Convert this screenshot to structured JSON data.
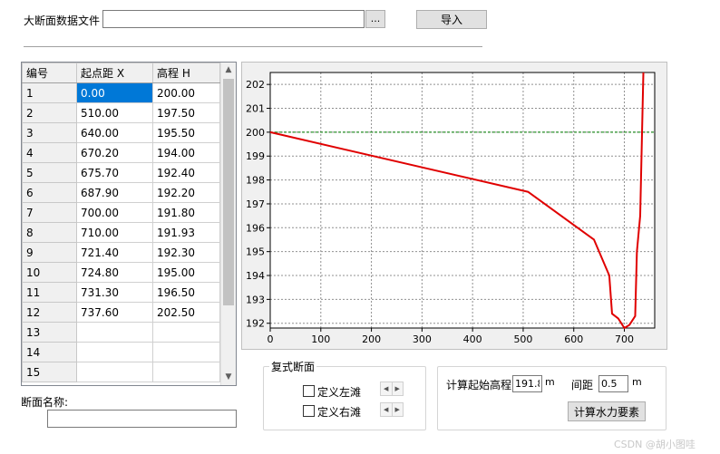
{
  "file_row": {
    "label": "大断面数据文件",
    "path_value": "",
    "browse_label": "...",
    "import_label": "导入"
  },
  "grid": {
    "headers": [
      "编号",
      "起点距 X",
      "高程 H"
    ],
    "rows": [
      [
        "1",
        "0.00",
        "200.00"
      ],
      [
        "2",
        "510.00",
        "197.50"
      ],
      [
        "3",
        "640.00",
        "195.50"
      ],
      [
        "4",
        "670.20",
        "194.00"
      ],
      [
        "5",
        "675.70",
        "192.40"
      ],
      [
        "6",
        "687.90",
        "192.20"
      ],
      [
        "7",
        "700.00",
        "191.80"
      ],
      [
        "8",
        "710.00",
        "191.93"
      ],
      [
        "9",
        "721.40",
        "192.30"
      ],
      [
        "10",
        "724.80",
        "195.00"
      ],
      [
        "11",
        "731.30",
        "196.50"
      ],
      [
        "12",
        "737.60",
        "202.50"
      ],
      [
        "13",
        "",
        ""
      ],
      [
        "14",
        "",
        ""
      ],
      [
        "15",
        "",
        ""
      ]
    ],
    "selected_row": 0,
    "scroll_up_icon": "chevron-up-icon",
    "scroll_down_icon": "chevron-down-icon"
  },
  "section_name": {
    "label": "断面名称:",
    "value": ""
  },
  "chart_data": {
    "type": "line",
    "xlim": [
      0,
      760
    ],
    "ylim": [
      191.8,
      202.5
    ],
    "xticks": [
      0,
      100,
      200,
      300,
      400,
      500,
      600,
      700
    ],
    "yticks": [
      192,
      193,
      194,
      195,
      196,
      197,
      198,
      199,
      200,
      201,
      202
    ],
    "grid": true,
    "series": [
      {
        "color": "#e00000",
        "x": [
          0,
          510,
          640,
          670.2,
          675.7,
          687.9,
          700,
          710,
          721.4,
          724.8,
          731.3,
          737.6
        ],
        "y": [
          200,
          197.5,
          195.5,
          194,
          192.4,
          192.2,
          191.8,
          191.93,
          192.3,
          195,
          196.5,
          202.5
        ]
      }
    ],
    "reference_line": {
      "y": 200,
      "color": "#008000",
      "style": "dashed"
    }
  },
  "compound_section": {
    "title": "复式断面",
    "define_left_label": "定义左滩",
    "define_right_label": "定义右滩",
    "spin_left_icon": "arrow-left-icon",
    "spin_right_icon": "arrow-right-icon"
  },
  "calc": {
    "start_elev_label": "计算起始高程",
    "start_elev_value": "191.8",
    "start_elev_unit": "m",
    "interval_label": "间距",
    "interval_value": "0.5",
    "interval_unit": "m",
    "compute_label": "计算水力要素"
  },
  "watermark": "CSDN @胡小图哇"
}
